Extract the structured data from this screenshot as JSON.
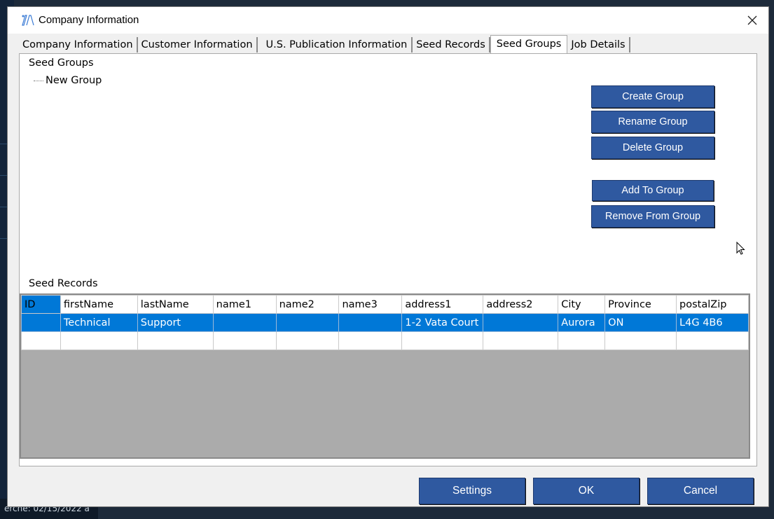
{
  "window": {
    "title": "Company Information"
  },
  "tabs": [
    {
      "label": "Company Information",
      "active": false
    },
    {
      "label": "Customer Information",
      "active": false
    },
    {
      "label": "U.S. Publication Information",
      "active": false
    },
    {
      "label": "Seed Records",
      "active": false
    },
    {
      "label": "Seed Groups",
      "active": true
    },
    {
      "label": "Job Details",
      "active": false
    }
  ],
  "seed_groups": {
    "heading": "Seed Groups",
    "items": [
      "New Group"
    ],
    "buttons": {
      "create": "Create Group",
      "rename": "Rename Group",
      "delete": "Delete Group",
      "add": "Add To Group",
      "remove": "Remove From Group"
    }
  },
  "seed_records": {
    "heading": "Seed Records",
    "columns": [
      "ID",
      "firstName",
      "lastName",
      "name1",
      "name2",
      "name3",
      "address1",
      "address2",
      "City",
      "Province",
      "postalZip"
    ],
    "rows": [
      [
        "",
        "Technical",
        "Support",
        "",
        "",
        "",
        "1-2 Vata Court",
        "",
        "Aurora",
        "ON",
        "L4G 4B6"
      ],
      [
        "",
        "",
        "",
        "",
        "",
        "",
        "",
        "",
        "",
        "",
        ""
      ]
    ],
    "selected_row": 0
  },
  "footer": {
    "settings": "Settings",
    "ok": "OK",
    "cancel": "Cancel"
  },
  "background": {
    "bottom_text": "erche: 02/15/2022 a"
  },
  "colors": {
    "accent": "#2f59a0",
    "selection": "#0078d7",
    "grid_empty": "#ababab"
  }
}
